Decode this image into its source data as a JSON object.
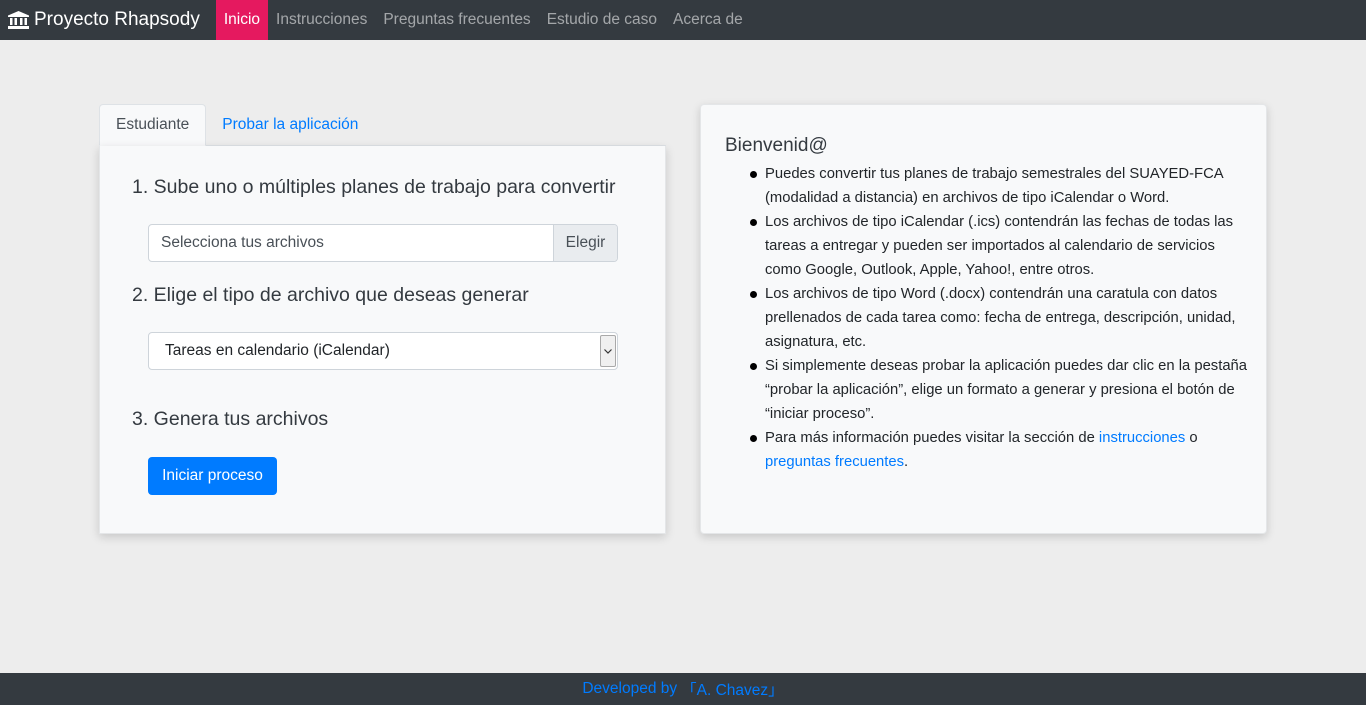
{
  "navbar": {
    "brand": "Proyecto Rhapsody",
    "brand_icon": "bank-icon",
    "links": [
      "Inicio",
      "Instrucciones",
      "Preguntas frecuentes",
      "Estudio de caso",
      "Acerca de"
    ],
    "active_color": "#e5195f"
  },
  "tabs": [
    "Estudiante",
    "Probar la aplicación"
  ],
  "form": {
    "step1_title": "1. Sube uno o múltiples planes de trabajo para convertir",
    "file_placeholder": "Selecciona tus archivos",
    "file_browse": "Elegir",
    "step2_title": "2. Elige el tipo de archivo que deseas generar",
    "select_value": "Tareas en calendario (iCalendar)",
    "step3_title": "3. Genera tus archivos",
    "submit_label": "Iniciar proceso"
  },
  "welcome": {
    "title": "Bienvenid@",
    "items": [
      "Puedes convertir tus planes de trabajo semestrales del SUAYED-FCA (modalidad a distancia) en archivos de tipo iCalendar o Word.",
      "Los archivos de tipo iCalendar (.ics) contendrán las fechas de todas las tareas a entregar y pueden ser importados al calendario de servicios como Google, Outlook, Apple, Yahoo!, entre otros.",
      "Los archivos de tipo Word (.docx) contendrán una caratula con datos prellenados de cada tarea como: fecha de entrega, descripción, unidad, asignatura, etc.",
      "Si simplemente deseas probar la aplicación puedes dar clic en la pestaña “probar la aplicación”, elige un formato a generar y presiona el botón de “iniciar proceso”."
    ],
    "last_item": {
      "prefix": "Para más información puedes visitar la sección de ",
      "link1": "instrucciones",
      "middle": " o ",
      "link2": "preguntas frecuentes",
      "suffix": "."
    }
  },
  "footer": {
    "text": "Developed by",
    "author": "「A. Chavez」",
    "link_color": "#007bff"
  }
}
